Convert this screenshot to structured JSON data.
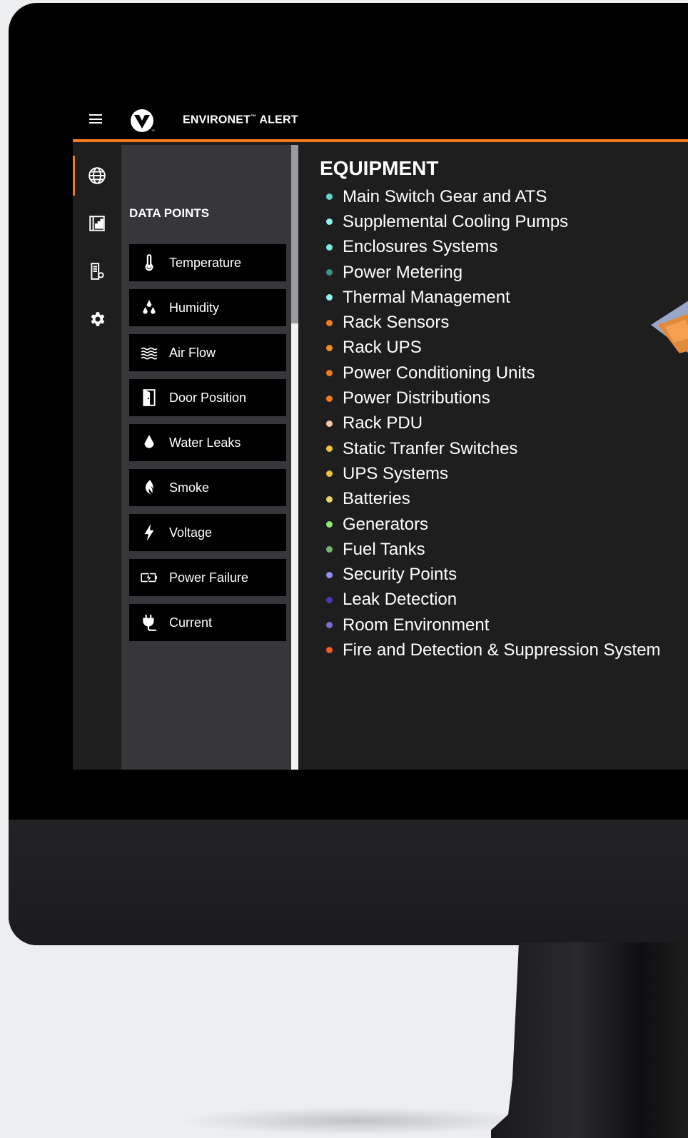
{
  "app": {
    "title": "ENVIRONET",
    "title_mark": "™",
    "title_suffix": " ALERT",
    "accent": "#f47a20"
  },
  "rail": [
    {
      "icon": "globe-icon",
      "active": true
    },
    {
      "icon": "report-chart-icon",
      "active": false
    },
    {
      "icon": "device-settings-icon",
      "active": false
    },
    {
      "icon": "gear-icon",
      "active": false
    }
  ],
  "data_points": {
    "title": "DATA POINTS",
    "items": [
      {
        "label": "Temperature",
        "icon": "thermometer-icon"
      },
      {
        "label": "Humidity",
        "icon": "droplets-icon"
      },
      {
        "label": "Air Flow",
        "icon": "airflow-waves-icon"
      },
      {
        "label": "Door Position",
        "icon": "door-icon"
      },
      {
        "label": "Water Leaks",
        "icon": "water-drop-icon"
      },
      {
        "label": "Smoke",
        "icon": "smoke-flame-icon"
      },
      {
        "label": "Voltage",
        "icon": "lightning-icon"
      },
      {
        "label": "Power Failure",
        "icon": "battery-bolt-icon"
      },
      {
        "label": "Current",
        "icon": "plug-icon"
      }
    ]
  },
  "equipment": {
    "title": "EQUIPMENT",
    "items": [
      {
        "label": "Main Switch Gear and ATS",
        "color": "#5ed6c8"
      },
      {
        "label": "Supplemental Cooling Pumps",
        "color": "#8ff0ec"
      },
      {
        "label": "Enclosures Systems",
        "color": "#7fe8e2"
      },
      {
        "label": "Power Metering",
        "color": "#3f8f88"
      },
      {
        "label": "Thermal Management",
        "color": "#8ff0ec"
      },
      {
        "label": "Rack Sensors",
        "color": "#f47a20"
      },
      {
        "label": "Rack UPS",
        "color": "#f48a20"
      },
      {
        "label": "Power Conditioning Units",
        "color": "#f47a20"
      },
      {
        "label": "Power Distributions",
        "color": "#f47a20"
      },
      {
        "label": "Rack PDU",
        "color": "#f6c9a0"
      },
      {
        "label": "Static Tranfer Switches",
        "color": "#f2c23a"
      },
      {
        "label": "UPS Systems",
        "color": "#e8c03e"
      },
      {
        "label": "Batteries",
        "color": "#f0cf6e"
      },
      {
        "label": "Generators",
        "color": "#8fe870"
      },
      {
        "label": "Fuel Tanks",
        "color": "#74b870"
      },
      {
        "label": "Security Points",
        "color": "#9090f0"
      },
      {
        "label": "Leak Detection",
        "color": "#4a38b8"
      },
      {
        "label": "Room Environment",
        "color": "#7a70d0"
      },
      {
        "label": "Fire and Detection & Suppression System",
        "color": "#f45a2a"
      }
    ]
  }
}
